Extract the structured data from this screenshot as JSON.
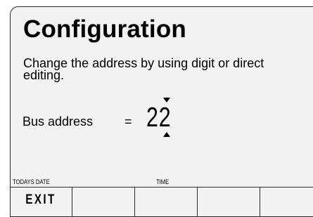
{
  "screen": {
    "title": "Configuration",
    "description": "Change the address by using digit or direct editing.",
    "bus_address_label": "Bus address",
    "equals_sign": "=",
    "bus_address_value": "22"
  },
  "status_labels": {
    "date_label": "TODAYS DATE",
    "time_label": "TIME"
  },
  "softkeys": [
    {
      "label": "EXIT"
    },
    {
      "label": ""
    },
    {
      "label": ""
    },
    {
      "label": ""
    },
    {
      "label": ""
    }
  ],
  "icons": {
    "increment": "triangle-up-icon",
    "decrement": "triangle-down-icon"
  }
}
